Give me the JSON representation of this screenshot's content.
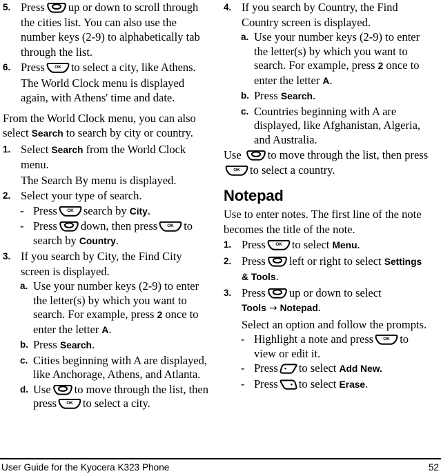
{
  "document": {
    "footer_title": "User Guide for the Kyocera K323 Phone",
    "page_number": "52"
  },
  "icons": {
    "nav_key": "navigation-key-icon",
    "ok_key": "ok-key-icon",
    "left_softkey": "left-softkey-icon",
    "right_softkey": "right-softkey-icon",
    "ok_label": "OK"
  },
  "left_column": {
    "step5": {
      "marker": "5.",
      "text_before": "Press",
      "text_after": "up or down to scroll through the cities list. You can also use the number keys (2-9) to alphabetically tab through the list."
    },
    "step6": {
      "marker": "6.",
      "text_before": "Press",
      "text_after": "to select a city, like Athens.",
      "result": "The World Clock menu is displayed again, with Athens' time and date."
    },
    "intro": {
      "part1": "From the World Clock menu, you can also select",
      "bold": "Search",
      "part2": "to search by city or country."
    },
    "step1": {
      "marker": "1.",
      "part1": "Select",
      "bold": "Search",
      "part2": "from the World Clock menu.",
      "result": "The Search By menu is displayed."
    },
    "step2": {
      "marker": "2.",
      "text": "Select your type of search.",
      "sub": [
        {
          "marker": "-",
          "part1": "Press",
          "part2": "search by",
          "bold": "City",
          "part3": "."
        },
        {
          "marker": "-",
          "part1": "Press",
          "part2": "down, then press",
          "part3": "to search by",
          "bold": "Country",
          "part4": "."
        }
      ]
    },
    "step3": {
      "marker": "3.",
      "text": "If you search by City, the Find City screen is displayed.",
      "sub": [
        {
          "marker": "a.",
          "part1": "Use your number keys (2-9) to enter the letter(s) by which you want to search. For example, press",
          "bold1": "2",
          "part2": "once to enter the letter",
          "bold2": "A",
          "part3": "."
        },
        {
          "marker": "b.",
          "part1": "Press",
          "bold1": "Search",
          "part2": "."
        },
        {
          "marker": "c.",
          "part1": "Cities beginning with A are displayed, like Anchorage, Athens, and Atlanta."
        },
        {
          "marker": "d.",
          "part1": "Use",
          "part2": "to move through the list, then press",
          "part3": "to select a city."
        }
      ]
    }
  },
  "right_column": {
    "step4": {
      "marker": "4.",
      "text": "If you search by Country, the Find Country screen is displayed.",
      "sub": [
        {
          "marker": "a.",
          "part1": "Use your number keys (2-9) to enter the letter(s) by which you want to search. For example, press",
          "bold1": "2",
          "part2": "once to enter the letter",
          "bold2": "A",
          "part3": "."
        },
        {
          "marker": "b.",
          "part1": "Press",
          "bold1": "Search",
          "part2": "."
        },
        {
          "marker": "c.",
          "part1": "Countries beginning with A are displayed, like Afghanistan, Algeria, and Australia."
        }
      ]
    },
    "use_paragraph": {
      "part1": "Use",
      "part2": "to move through the list, then press",
      "part3": "to select a country."
    },
    "notepad": {
      "heading": "Notepad",
      "intro": "Use to enter notes. The first line of the note becomes the title of the note.",
      "step1": {
        "marker": "1.",
        "part1": "Press",
        "part2": "to select",
        "bold": "Menu",
        "part3": "."
      },
      "step2": {
        "marker": "2.",
        "part1": "Press",
        "part2": "left or right to select",
        "bold": "Settings & Tools",
        "part3": "."
      },
      "step3": {
        "marker": "3.",
        "part1": "Press",
        "part2": "up or down to select",
        "bold1": "Tools",
        "arrow": "→",
        "bold2": "Notepad",
        "part3": ".",
        "result": "Select an option and follow the prompts.",
        "sub": [
          {
            "marker": "-",
            "part1": "Highlight a note and press",
            "part2": "to view or edit it."
          },
          {
            "marker": "-",
            "part1": "Press",
            "part2": "to select",
            "bold": "Add New.",
            "part3": ""
          },
          {
            "marker": "-",
            "part1": "Press",
            "part2": "to select",
            "bold": "Erase",
            "part3": "."
          }
        ]
      }
    }
  }
}
